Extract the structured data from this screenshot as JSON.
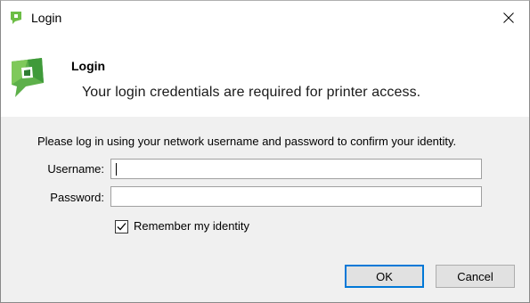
{
  "window": {
    "title": "Login"
  },
  "header": {
    "title": "Login",
    "subtitle": "Your login credentials are required for printer access."
  },
  "form": {
    "intro": "Please log in using your network username and password to confirm your identity.",
    "username_label": "Username:",
    "username_value": "",
    "password_label": "Password:",
    "password_value": "",
    "remember_label": "Remember my identity",
    "remember_checked": true
  },
  "buttons": {
    "ok_label": "OK",
    "cancel_label": "Cancel"
  },
  "colors": {
    "logo_green": "#5db04a",
    "logo_dark_green": "#2f7d32",
    "accent_blue": "#0078d7",
    "body_bg": "#f0f0f0"
  }
}
